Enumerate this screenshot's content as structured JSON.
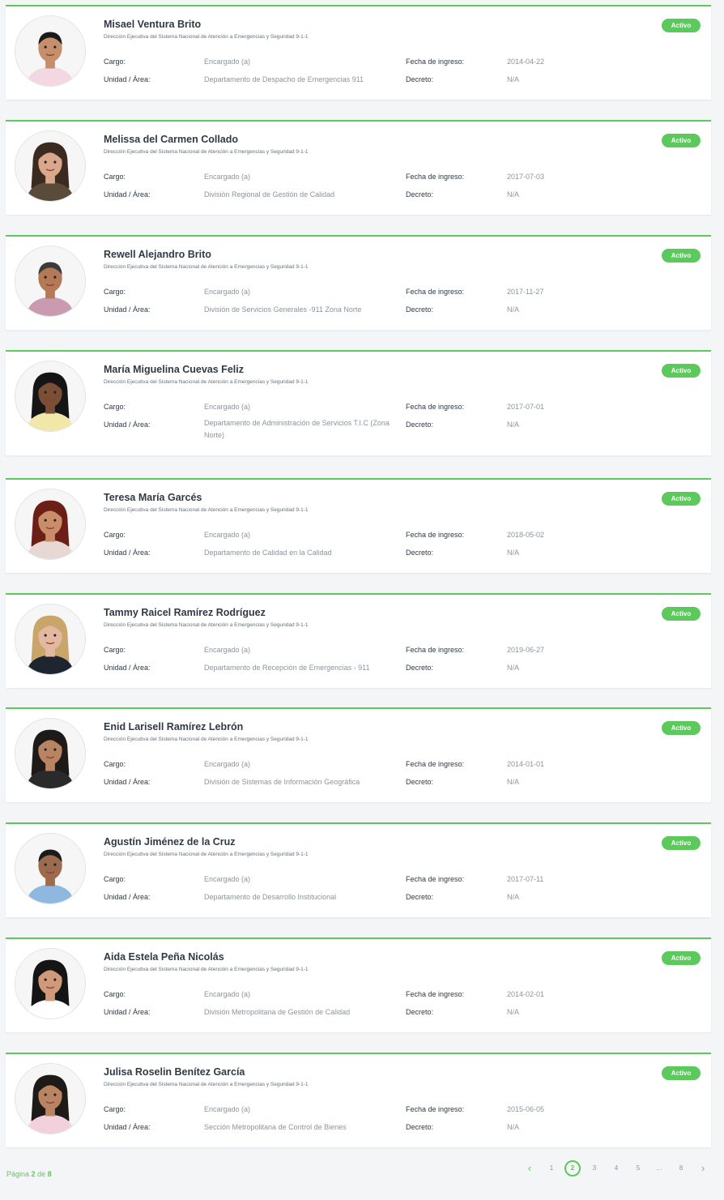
{
  "labels": {
    "cargo": "Cargo:",
    "unidad": "Unidad / Área:",
    "fecha": "Fecha de ingreso:",
    "decreto": "Decreto:"
  },
  "institution": "Dirección Ejecutiva del Sistema Nacional de Atención a Emergencias y Seguridad 9-1-1",
  "employees": [
    {
      "name": "Misael Ventura Brito",
      "cargo": "Encargado (a)",
      "unidad": "Departamento de Despacho de Emergencias 911",
      "fecha": "2014-04-22",
      "decreto": "N/A",
      "status": "Activo"
    },
    {
      "name": "Melissa del Carmen Collado",
      "cargo": "Encargado (a)",
      "unidad": "División Regional de Gestión de Calidad",
      "fecha": "2017-07-03",
      "decreto": "N/A",
      "status": "Activo"
    },
    {
      "name": "Rewell Alejandro Brito",
      "cargo": "Encargado (a)",
      "unidad": "División de Servicios Generales -911 Zona Norte",
      "fecha": "2017-11-27",
      "decreto": "N/A",
      "status": "Activo"
    },
    {
      "name": "María Miguelina Cuevas Feliz",
      "cargo": "Encargado (a)",
      "unidad": "Departamento de Administración de Servicios T.I.C (Zona Norte)",
      "fecha": "2017-07-01",
      "decreto": "N/A",
      "status": "Activo"
    },
    {
      "name": "Teresa María Garcés",
      "cargo": "Encargado (a)",
      "unidad": "Departamento de Calidad en la Calidad",
      "fecha": "2018-05-02",
      "decreto": "N/A",
      "status": "Activo"
    },
    {
      "name": "Tammy Raicel Ramírez Rodríguez",
      "cargo": "Encargado (a)",
      "unidad": "Departamento de Recepción de Emergencias - 911",
      "fecha": "2019-06-27",
      "decreto": "N/A",
      "status": "Activo"
    },
    {
      "name": "Enid Larisell Ramírez Lebrón",
      "cargo": "Encargado (a)",
      "unidad": "División de Sistemas de Información Geográfica",
      "fecha": "2014-01-01",
      "decreto": "N/A",
      "status": "Activo"
    },
    {
      "name": "Agustín Jiménez de la Cruz",
      "cargo": "Encargado (a)",
      "unidad": "Departamento de Desarrollo Institucional",
      "fecha": "2017-07-11",
      "decreto": "N/A",
      "status": "Activo"
    },
    {
      "name": "Aida Estela Peña Nicolás",
      "cargo": "Encargado (a)",
      "unidad": "División Metropolitana de Gestión de Calidad",
      "fecha": "2014-02-01",
      "decreto": "N/A",
      "status": "Activo"
    },
    {
      "name": "Julisa Roselin Benítez García",
      "cargo": "Encargado (a)",
      "unidad": "Sección Metropolitana de Control de Bienes",
      "fecha": "2015-06-05",
      "decreto": "N/A",
      "status": "Activo"
    }
  ],
  "pagination": {
    "page_word": "Página",
    "current": "2",
    "of_word": "de",
    "total": "8",
    "pages": [
      "1",
      "2",
      "3",
      "4",
      "5",
      "…",
      "8"
    ],
    "prev_icon": "chevron-left-icon",
    "next_icon": "chevron-right-icon"
  },
  "colors": {
    "accent": "#5cc95c",
    "text": "#2f3a45",
    "muted": "#8c949c"
  }
}
